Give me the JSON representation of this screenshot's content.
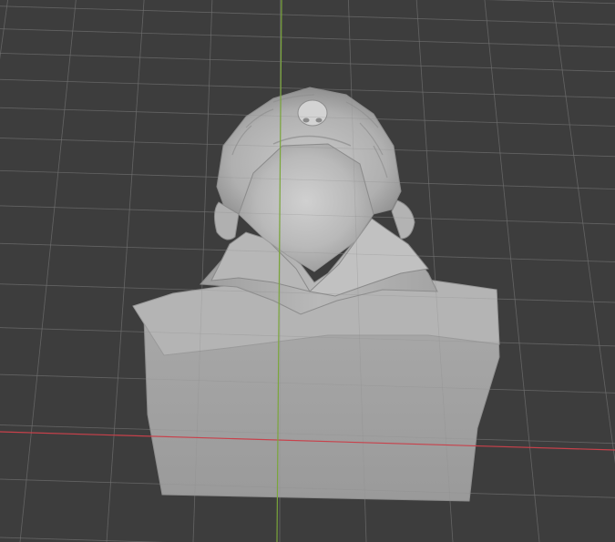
{
  "viewport": {
    "background_color": "#3d3d3d",
    "grid_line_color": "#4e4e4e",
    "grid_line_color_major": "#575757",
    "x_axis_color": "#c8414b",
    "y_axis_color": "#7aa63a",
    "model_base_color": "#a3a3a3",
    "model_light_color": "#c4c4c4",
    "model_shadow_color": "#7c7c7c"
  },
  "scene": {
    "object": "bust-sculpt-model",
    "view": "looking-up-from-below"
  }
}
